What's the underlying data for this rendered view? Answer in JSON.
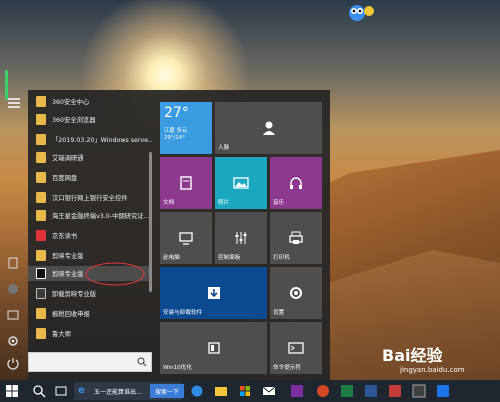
{
  "start_menu": {
    "apps": [
      {
        "label": "360安全中心",
        "kind": "folder"
      },
      {
        "label": "360安全浏览器",
        "kind": "folder"
      },
      {
        "label": "「2019.03.20」Windows serve...",
        "kind": "folder"
      },
      {
        "label": "艾瑞调研通",
        "kind": "folder"
      },
      {
        "label": "百度网盘",
        "kind": "folder"
      },
      {
        "label": "汉口银行网上银行安全控件",
        "kind": "folder"
      },
      {
        "label": "海王星金融终端v3.0-中期研究证...",
        "kind": "folder"
      },
      {
        "label": "京东读书",
        "kind": "red"
      },
      {
        "label": "剪映专业版",
        "kind": "folder"
      },
      {
        "label": "剪映专业版",
        "kind": "capcut",
        "selected": true
      },
      {
        "label": "卸载剪映专业版",
        "kind": "dark"
      },
      {
        "label": "报税回收申报",
        "kind": "folder"
      },
      {
        "label": "鲁大师",
        "kind": "folder"
      }
    ],
    "search_placeholder": ""
  },
  "tiles": {
    "weather": {
      "temp": "27°",
      "city": "江夏 多云",
      "range": "29°/14°"
    },
    "people": "人脉",
    "docs": "文档",
    "photos": "照片",
    "music": "音乐",
    "this_pc": "此电脑",
    "control_panel": "控制面板",
    "printer": "打印机",
    "install_uninstall": "安装与卸载软件",
    "settings": "设置",
    "win10_optimize": "Win10优化",
    "cmd": "命令提示符"
  },
  "taskbar": {
    "active_window": "五一还能算谁出...",
    "search_button": "搜索一下"
  },
  "watermark": {
    "brand": "Bai经验",
    "url": "jingyan.baidu.com"
  },
  "colors": {
    "weather_tile": "#3a9be0",
    "docs_tile": "#8c3a8e",
    "photos_tile": "#1aa7bf",
    "music_tile": "#8c3a8e",
    "install_tile": "#0b4a90",
    "gray_tile": "#4e4e4e"
  }
}
